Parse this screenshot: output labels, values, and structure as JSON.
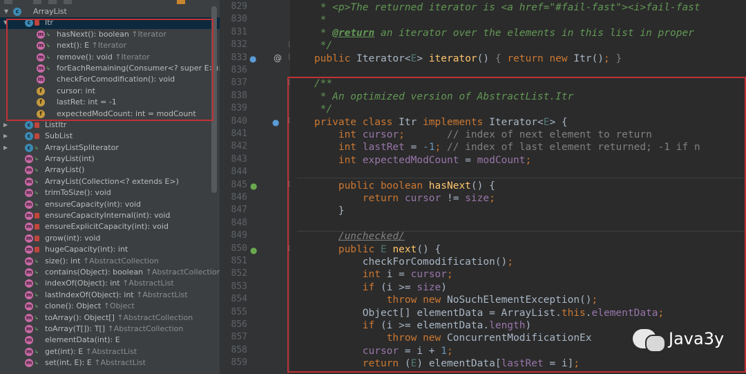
{
  "structure": {
    "root": "ArrayList",
    "items": [
      {
        "indent": 1,
        "arrow": "▼",
        "icon": "c",
        "vis": "lock",
        "text": "Itr",
        "inh": "",
        "selected": true
      },
      {
        "indent": 2,
        "icon": "m",
        "vis": "pub",
        "text": "hasNext(): boolean ",
        "inh": "↑Iterator"
      },
      {
        "indent": 2,
        "icon": "m",
        "vis": "pub",
        "text": "next(): E ",
        "inh": "↑Iterator"
      },
      {
        "indent": 2,
        "icon": "m",
        "vis": "pub",
        "text": "remove(): void ",
        "inh": "↑Iterator"
      },
      {
        "indent": 2,
        "icon": "m",
        "vis": "pub",
        "text": "forEachRemaining(Consumer<? super E>): void",
        "inh": ""
      },
      {
        "indent": 2,
        "icon": "m",
        "vis": "",
        "text": "checkForComodification(): void",
        "inh": ""
      },
      {
        "indent": 2,
        "icon": "f",
        "vis": "",
        "text": "cursor: int",
        "inh": ""
      },
      {
        "indent": 2,
        "icon": "f",
        "vis": "",
        "text": "lastRet: int = -1",
        "inh": ""
      },
      {
        "indent": 2,
        "icon": "f",
        "vis": "",
        "text": "expectedModCount: int = modCount",
        "inh": ""
      },
      {
        "indent": 1,
        "arrow": "▶",
        "icon": "c",
        "vis": "lock",
        "text": "ListItr",
        "inh": ""
      },
      {
        "indent": 1,
        "arrow": "▶",
        "icon": "c",
        "vis": "lock",
        "text": "SubList",
        "inh": ""
      },
      {
        "indent": 1,
        "arrow": "▶",
        "icon": "c",
        "vis": "pub",
        "text": "ArrayListSpliterator",
        "inh": ""
      },
      {
        "indent": 1,
        "icon": "m",
        "vis": "pub",
        "text": "ArrayList(int)",
        "inh": ""
      },
      {
        "indent": 1,
        "icon": "m",
        "vis": "pub",
        "text": "ArrayList()",
        "inh": ""
      },
      {
        "indent": 1,
        "icon": "m",
        "vis": "pub",
        "text": "ArrayList(Collection<? extends E>)",
        "inh": ""
      },
      {
        "indent": 1,
        "icon": "m",
        "vis": "pub",
        "text": "trimToSize(): void",
        "inh": ""
      },
      {
        "indent": 1,
        "icon": "m",
        "vis": "pub",
        "text": "ensureCapacity(int): void",
        "inh": ""
      },
      {
        "indent": 1,
        "icon": "m",
        "vis": "lock",
        "text": "ensureCapacityInternal(int): void",
        "inh": ""
      },
      {
        "indent": 1,
        "icon": "m",
        "vis": "lock",
        "text": "ensureExplicitCapacity(int): void",
        "inh": ""
      },
      {
        "indent": 1,
        "icon": "m",
        "vis": "lock",
        "text": "grow(int): void",
        "inh": ""
      },
      {
        "indent": 1,
        "icon": "m",
        "vis": "lock",
        "text": "hugeCapacity(int): int",
        "inh": ""
      },
      {
        "indent": 1,
        "icon": "m",
        "vis": "pub",
        "text": "size(): int ",
        "inh": "↑AbstractCollection"
      },
      {
        "indent": 1,
        "icon": "m",
        "vis": "pub",
        "text": "contains(Object): boolean ",
        "inh": "↑AbstractCollection"
      },
      {
        "indent": 1,
        "icon": "m",
        "vis": "pub",
        "text": "indexOf(Object): int ",
        "inh": "↑AbstractList"
      },
      {
        "indent": 1,
        "icon": "m",
        "vis": "pub",
        "text": "lastIndexOf(Object): int ",
        "inh": "↑AbstractList"
      },
      {
        "indent": 1,
        "icon": "m",
        "vis": "pub",
        "text": "clone(): Object ",
        "inh": "↑Object"
      },
      {
        "indent": 1,
        "icon": "m",
        "vis": "pub",
        "text": "toArray(): Object[] ",
        "inh": "↑AbstractCollection"
      },
      {
        "indent": 1,
        "icon": "m",
        "vis": "pub",
        "text": "toArray(T[]): T[] ",
        "inh": "↑AbstractCollection"
      },
      {
        "indent": 1,
        "icon": "m",
        "vis": "",
        "text": "elementData(int): E",
        "inh": ""
      },
      {
        "indent": 1,
        "icon": "m",
        "vis": "pub",
        "text": "get(int): E ",
        "inh": "↑AbstractList"
      },
      {
        "indent": 1,
        "icon": "m",
        "vis": "pub",
        "text": "set(int, E): E ",
        "inh": "↑AbstractList"
      }
    ]
  },
  "editor": {
    "lines": [
      {
        "n": "829",
        "html": "     <span class=\"cm\">* &lt;p&gt;The returned iterator is &lt;a href=\"#fail-fast\"&gt;&lt;i&gt;fail-fast</span>"
      },
      {
        "n": "830",
        "html": "     <span class=\"cm\">*</span>"
      },
      {
        "n": "831",
        "html": "     <span class=\"cm\">* </span><span class=\"tag\">@return</span><span class=\"cm\"> an iterator over the elements in this list in proper</span>"
      },
      {
        "n": "832",
        "html": "     <span class=\"cm\">*/</span>"
      },
      {
        "n": "833",
        "html": "    <span class=\"kw\">public</span> Iterator&lt;<span class=\"ty\">E</span>&gt; <span class=\"fn\">iterator</span>() <span class=\"lc\">{</span> <span class=\"kw\">return new</span> Itr()<span class=\"kw\">;</span> <span class=\"lc\">}</span>"
      },
      {
        "n": "836",
        "html": ""
      },
      {
        "n": "837",
        "html": "    <span class=\"cm\">/**</span>"
      },
      {
        "n": "838",
        "html": "     <span class=\"cm\">* An optimized version of AbstractList.Itr</span>"
      },
      {
        "n": "839",
        "html": "     <span class=\"cm\">*/</span>"
      },
      {
        "n": "840",
        "html": "    <span class=\"kw\">private class</span> Itr <span class=\"kw\">implements</span> Iterator&lt;<span class=\"ty\">E</span>&gt; {"
      },
      {
        "n": "841",
        "html": "        <span class=\"kw\">int</span> <span class=\"fd\">cursor</span><span class=\"kw\">;</span>       <span class=\"lc\">// index of next element to return</span>"
      },
      {
        "n": "842",
        "html": "        <span class=\"kw\">int</span> <span class=\"fd\">lastRet</span> = <span class=\"nm\">-1</span><span class=\"kw\">;</span> <span class=\"lc\">// index of last element returned; -1 if n</span>"
      },
      {
        "n": "843",
        "html": "        <span class=\"kw\">int</span> <span class=\"fd\">expectedModCount</span> = <span class=\"fd\">modCount</span><span class=\"kw\">;</span>"
      },
      {
        "n": "844",
        "html": ""
      },
      {
        "n": "845",
        "html": "        <span class=\"kw\">public boolean</span> <span class=\"fn\">hasNext</span>() {"
      },
      {
        "n": "846",
        "html": "            <span class=\"kw\">return</span> <span class=\"fd\">cursor</span> != <span class=\"fd\">size</span><span class=\"kw\">;</span>"
      },
      {
        "n": "847",
        "html": "        }"
      },
      {
        "n": "848",
        "html": ""
      },
      {
        "n": "849",
        "html": "        <span class=\"unch\">/unchecked/</span>"
      },
      {
        "n": "850",
        "html": "        <span class=\"kw\">public</span> <span class=\"ty\">E</span> <span class=\"fn\">next</span>() {"
      },
      {
        "n": "851",
        "html": "            checkForComodification()<span class=\"kw\">;</span>"
      },
      {
        "n": "852",
        "html": "            <span class=\"kw\">int</span> i = <span class=\"fd\">cursor</span><span class=\"kw\">;</span>"
      },
      {
        "n": "853",
        "html": "            <span class=\"kw\">if</span> (i &gt;= <span class=\"fd\">size</span>)"
      },
      {
        "n": "854",
        "html": "                <span class=\"kw\">throw new</span> NoSuchElementException()<span class=\"kw\">;</span>"
      },
      {
        "n": "855",
        "html": "            Object[] elementData = ArrayList.<span class=\"kw\">this</span>.<span class=\"fd\">elementData</span><span class=\"kw\">;</span>"
      },
      {
        "n": "856",
        "html": "            <span class=\"kw\">if</span> (i &gt;= elementData.<span class=\"fd\">length</span>)"
      },
      {
        "n": "857",
        "html": "                <span class=\"kw\">throw new</span> ConcurrentModificationEx"
      },
      {
        "n": "858",
        "html": "            <span class=\"fd\">cursor</span> = i + <span class=\"nm\">1</span><span class=\"kw\">;</span>"
      },
      {
        "n": "859",
        "html": "            <span class=\"kw\">return</span> (<span class=\"ty\">E</span>) elementData[<span class=\"fd\">lastRet</span> = i]<span class=\"kw\">;</span>"
      }
    ]
  },
  "watermark": "Java3y",
  "colors": {
    "highlight": "#c13236",
    "selection": "#0d293e",
    "background": "#2b2b2b"
  }
}
